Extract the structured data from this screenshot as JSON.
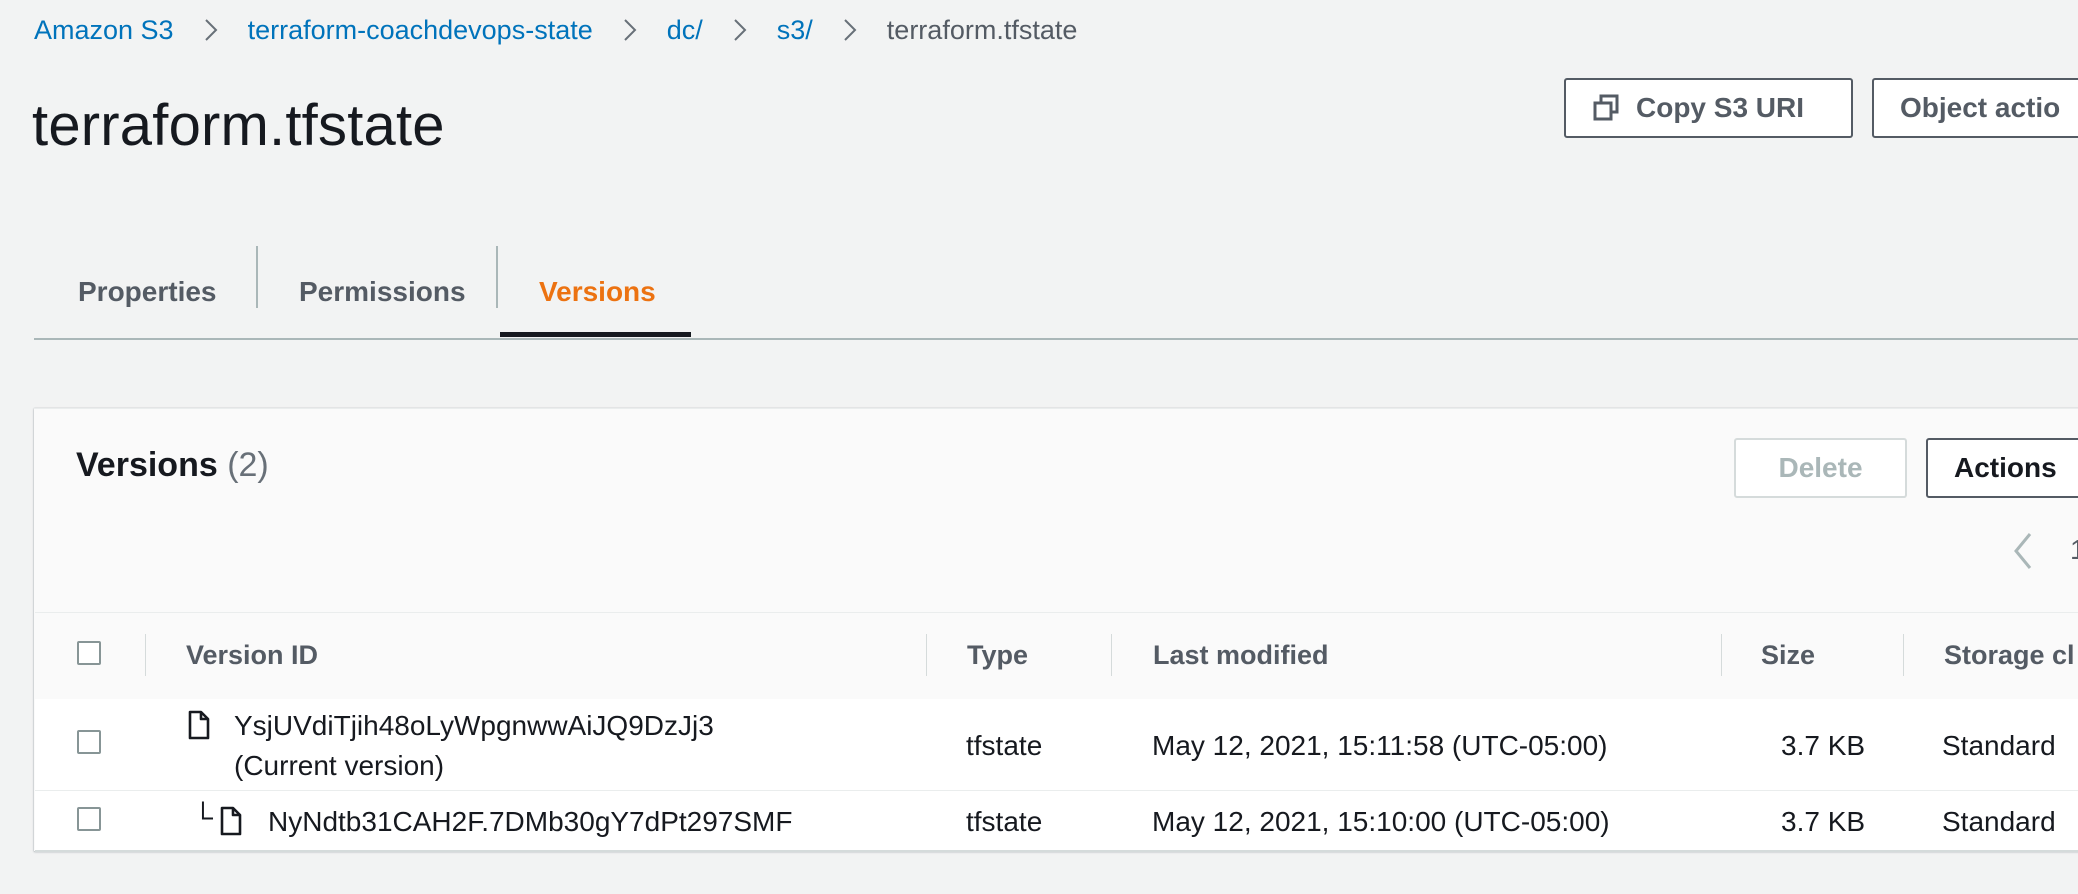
{
  "breadcrumb": {
    "items": [
      "Amazon S3",
      "terraform-coachdevops-state",
      "dc/",
      "s3/"
    ],
    "current": "terraform.tfstate"
  },
  "page_title": "terraform.tfstate",
  "header_buttons": {
    "copy_uri": "Copy S3 URI",
    "object_actions": "Object actio"
  },
  "tabs": [
    {
      "label": "Properties",
      "active": false
    },
    {
      "label": "Permissions",
      "active": false
    },
    {
      "label": "Versions",
      "active": true
    }
  ],
  "versions_panel": {
    "title": "Versions",
    "count": "(2)",
    "delete_label": "Delete",
    "actions_label": "Actions",
    "pager_edge": "1"
  },
  "table": {
    "columns": [
      "Version ID",
      "Type",
      "Last modified",
      "Size",
      "Storage cl"
    ],
    "rows": [
      {
        "version_id": "YsjUVdiTjih48oLyWpgnwwAiJQ9DzJj3",
        "note": "(Current version)",
        "type": "tfstate",
        "last_modified": "May 12, 2021, 15:11:58 (UTC-05:00)",
        "size": "3.7 KB",
        "storage_class": "Standard"
      },
      {
        "version_id": "NyNdtb31CAH2F.7DMb30gY7dPt297SMF",
        "tree_prefix": "└",
        "type": "tfstate",
        "last_modified": "May 12, 2021, 15:10:00 (UTC-05:00)",
        "size": "3.7 KB",
        "storage_class": "Standard"
      }
    ]
  },
  "colors": {
    "link": "#0073bb",
    "active_tab": "#ec7211",
    "text": "#16191f",
    "muted": "#545b64",
    "background": "#f2f3f3"
  },
  "icons": [
    "chevron-right-icon",
    "copy-icon",
    "file-icon",
    "chevron-left-icon"
  ]
}
